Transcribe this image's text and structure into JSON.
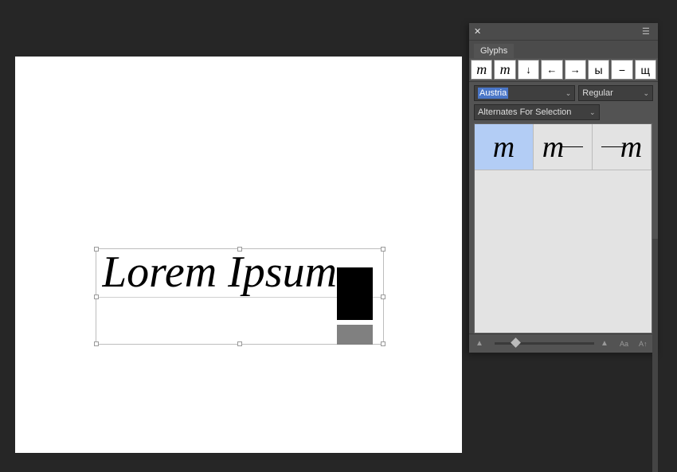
{
  "canvas": {
    "text": "Lorem Ipsum"
  },
  "glyphs_panel": {
    "title": "Glyphs",
    "recent": [
      "m",
      "m",
      "↓",
      "←",
      "→",
      "ы",
      "−",
      "щ"
    ],
    "font_family": "Austria",
    "font_weight": "Regular",
    "subset_label": "Alternates For Selection",
    "alternates": [
      "m",
      "m",
      "m"
    ],
    "footer_icons": [
      "zoom-out-icon",
      "font-preview-icon",
      "font-increase-icon"
    ]
  }
}
